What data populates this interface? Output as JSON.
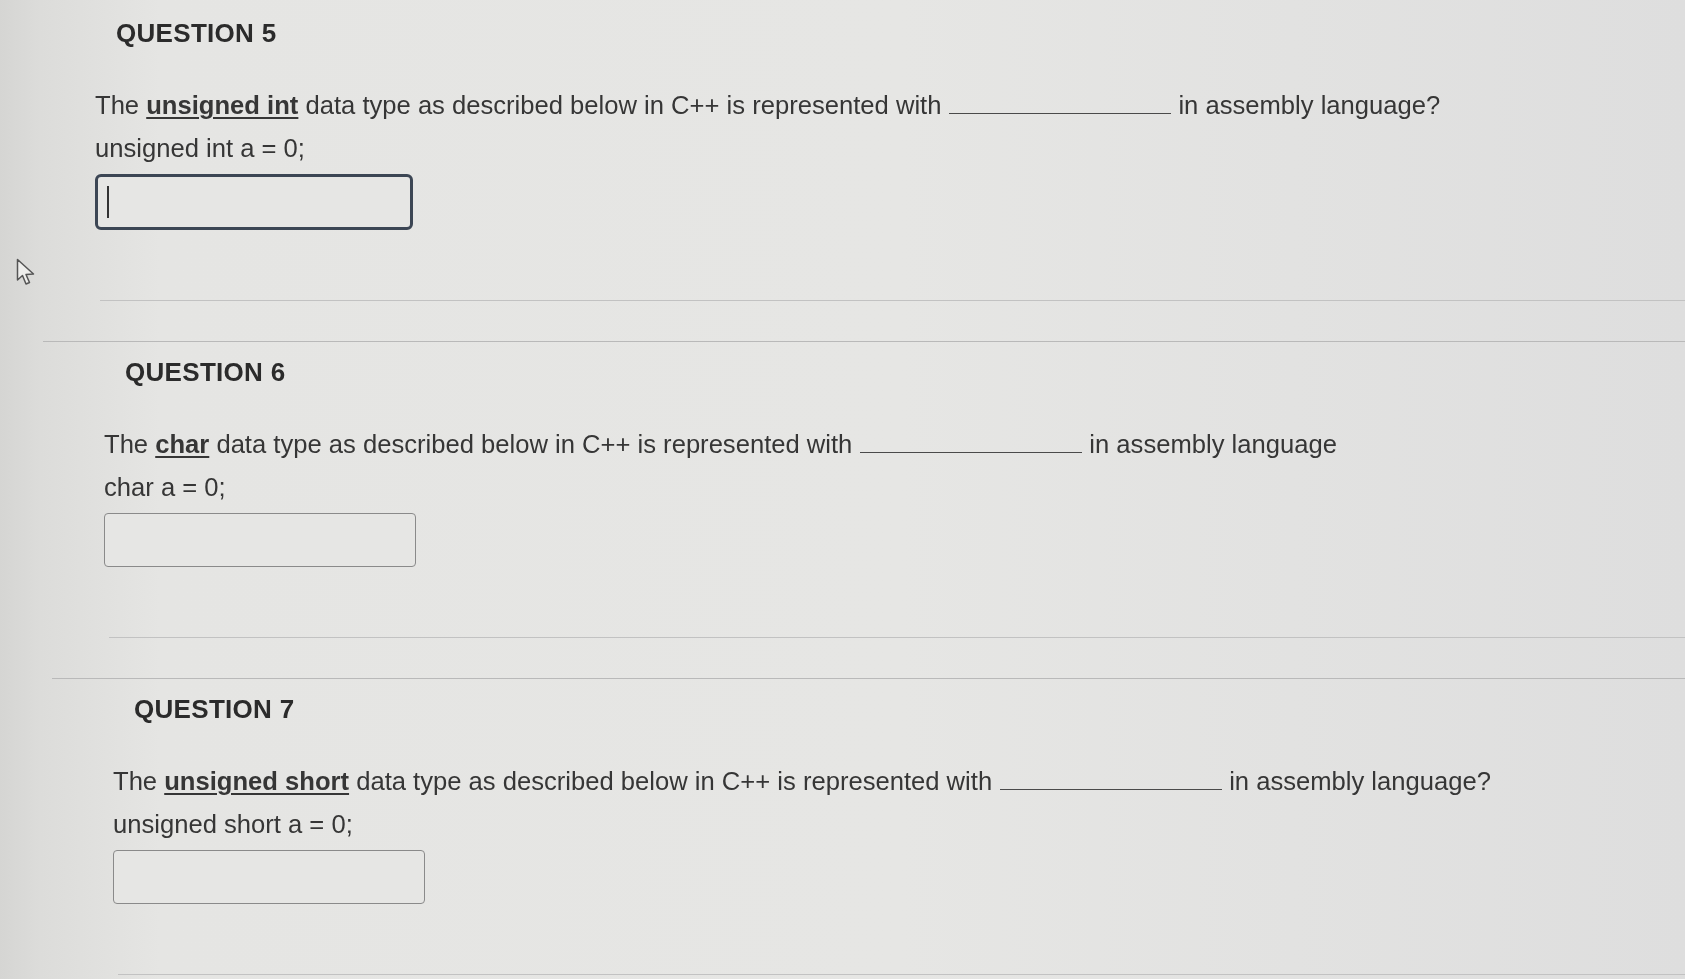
{
  "questions": [
    {
      "title": "QUESTION 5",
      "prompt_start": "The **unsigned int** data type as described below in C++ is represented with",
      "prompt_end": "in assembly language?",
      "code": "unsigned int a = 0;",
      "answer": {
        "focused": true
      }
    },
    {
      "title": "QUESTION 6",
      "prompt_start": "The **char** data type as described below in C++ is represented with",
      "prompt_end": "in assembly language",
      "code": "char a = 0;",
      "answer": {
        "focused": false
      }
    },
    {
      "title": "QUESTION 7",
      "prompt_start": "The **unsigned short** data type as described below in C++ is represented with",
      "prompt_end": "in assembly language?",
      "code": "unsigned short a = 0;",
      "answer": {
        "focused": false
      }
    }
  ]
}
